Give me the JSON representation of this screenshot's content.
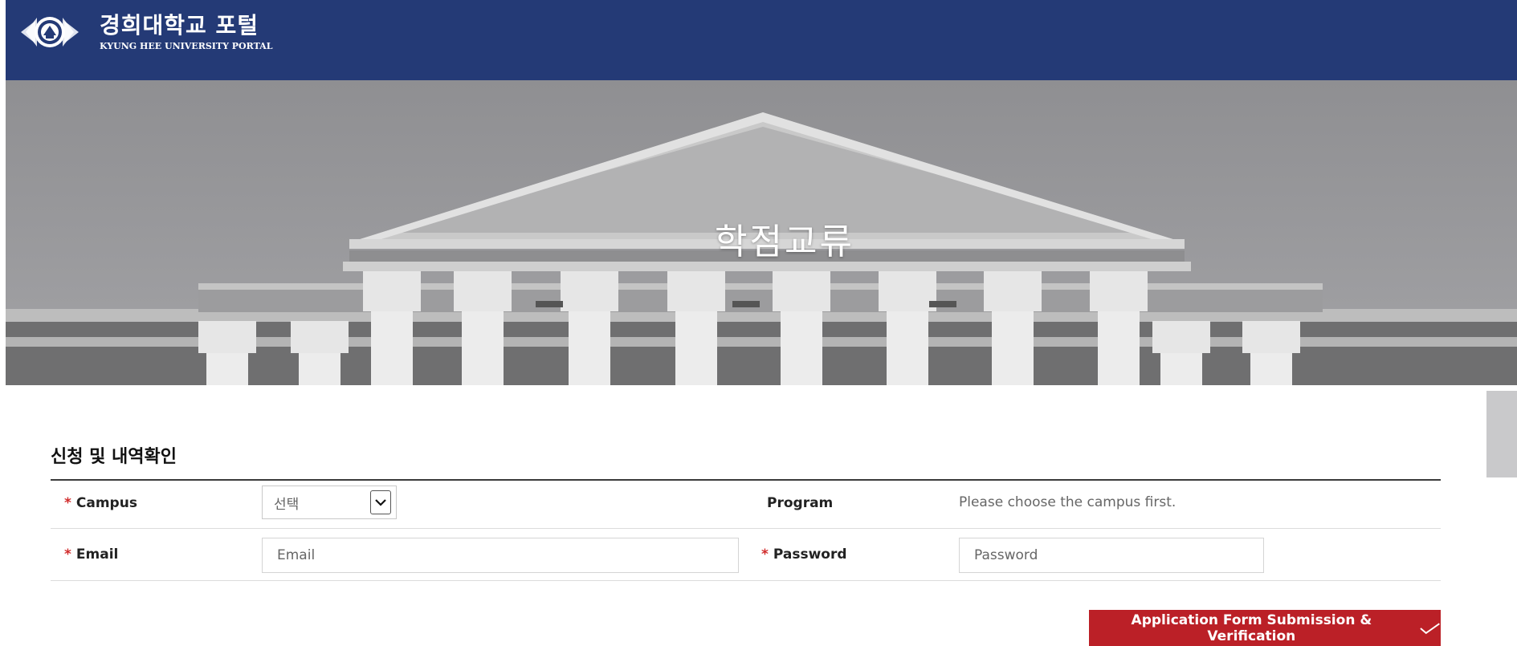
{
  "header": {
    "title_ko": "경희대학교 포털",
    "title_en": "KYUNG HEE UNIVERSITY PORTAL",
    "bg_color": "#243a76"
  },
  "hero": {
    "title": "학점교류"
  },
  "form": {
    "section_title": "신청 및 내역확인",
    "required_mark": "*",
    "campus": {
      "label": "Campus",
      "selected": "선택"
    },
    "program": {
      "label": "Program",
      "value": "Please choose the campus first."
    },
    "email": {
      "label": "Email",
      "placeholder": "Email"
    },
    "password": {
      "label": "Password",
      "placeholder": "Password"
    },
    "submit_label": "Application Form Submission & Verification",
    "accent_color": "#bb2027"
  }
}
